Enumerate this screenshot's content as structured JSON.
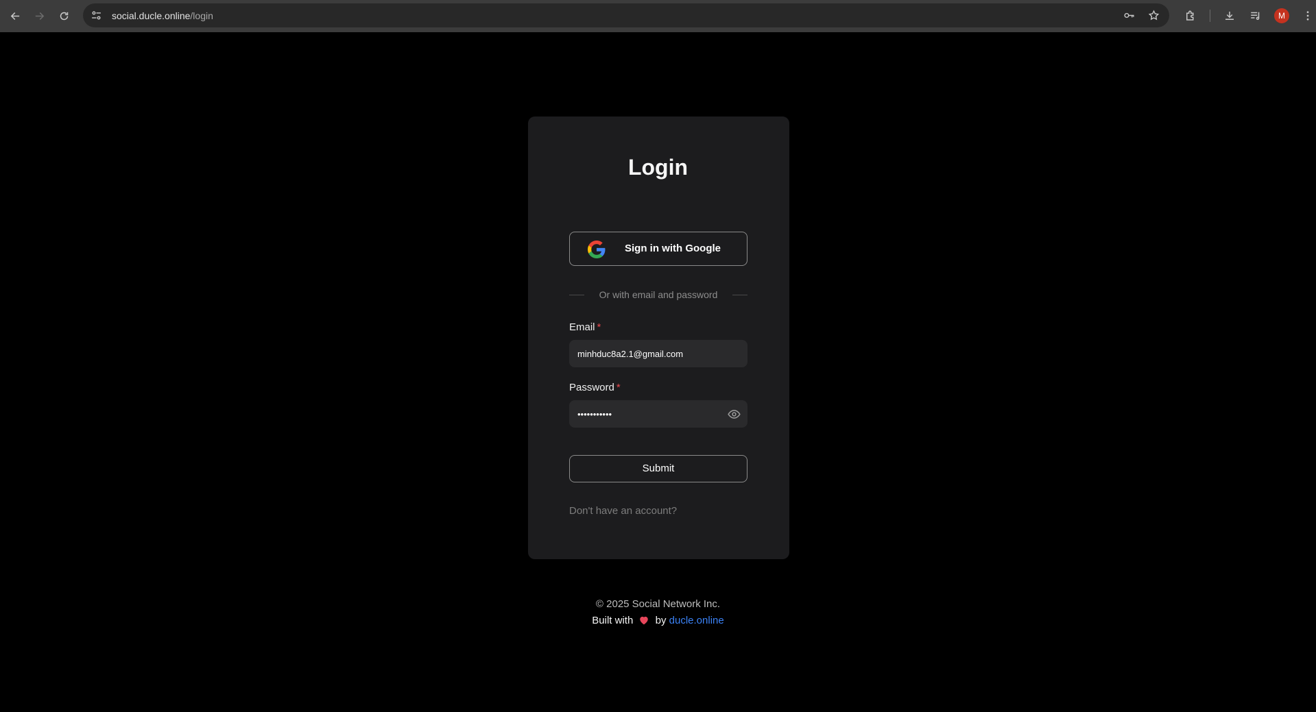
{
  "browser": {
    "url_host": "social.ducle.online",
    "url_path": "/login",
    "profile_initial": "M"
  },
  "login": {
    "title": "Login",
    "google_button_label": "Sign in with Google",
    "divider_text": "Or with email and password",
    "email_label": "Email",
    "email_value": "minhduc8a2.1@gmail.com",
    "password_label": "Password",
    "password_value": "•••••••••••",
    "required_marker": "*",
    "submit_label": "Submit",
    "signup_prompt": "Don't have an account?"
  },
  "footer": {
    "copyright": "© 2025 Social Network Inc.",
    "built_with": "Built with",
    "by": "by",
    "link_text": "ducle.online"
  },
  "colors": {
    "background": "#000000",
    "card": "#1c1c1e",
    "input_bg": "#2a2a2c",
    "required": "#e5484d",
    "link": "#3b82f6",
    "heart": "#e8465b"
  },
  "icons": [
    "back-icon",
    "forward-icon",
    "reload-icon",
    "site-info-icon",
    "key-icon",
    "star-icon",
    "extensions-icon",
    "download-icon",
    "reading-list-icon",
    "menu-icon",
    "google-logo-icon",
    "eye-icon",
    "heart-icon"
  ]
}
